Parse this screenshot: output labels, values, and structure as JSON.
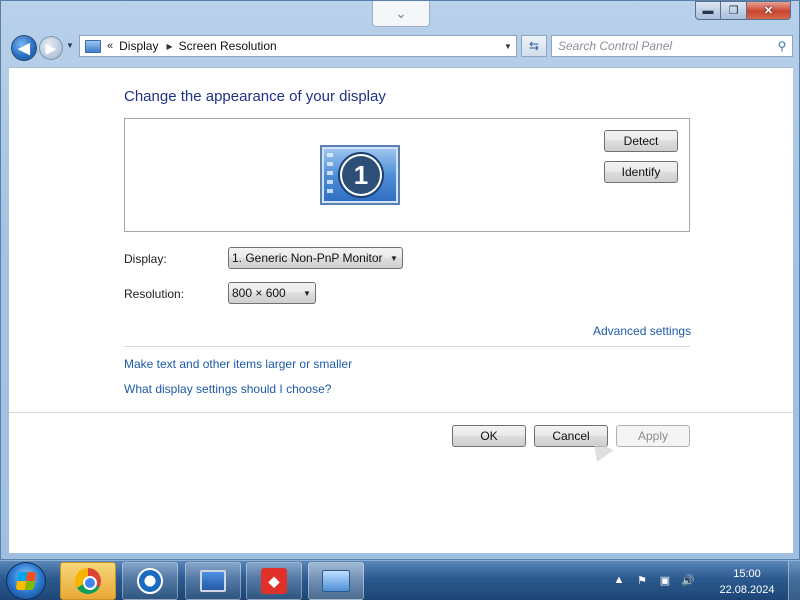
{
  "window": {
    "caption_minimize": "▬",
    "caption_maximize": "❐",
    "caption_close": "✕",
    "notch_glyph": "⌄"
  },
  "navbar": {
    "breadcrumb": [
      "Display",
      "Screen Resolution"
    ],
    "search_placeholder": "Search Control Panel"
  },
  "main": {
    "title": "Change the appearance of your display",
    "monitor_number": "1",
    "detect_label": "Detect",
    "identify_label": "Identify",
    "display_label": "Display:",
    "display_value": "1. Generic Non-PnP Monitor",
    "resolution_label": "Resolution:",
    "resolution_value": "800 × 600",
    "advanced_link": "Advanced settings",
    "larger_link": "Make text and other items larger or smaller",
    "choose_link": "What display settings should I choose?",
    "ok_label": "OK",
    "cancel_label": "Cancel",
    "apply_label": "Apply"
  },
  "taskbar": {
    "items": [
      "chrome-icon",
      "app-triangle-icon",
      "monitor-app-icon",
      "anydesk-icon",
      "control-panel-icon"
    ],
    "time": "15:00",
    "date": "22.08.2024"
  },
  "colors": {
    "link": "#1e5aa8",
    "title": "#1e3287",
    "taskbar": "#2c5a8f"
  }
}
